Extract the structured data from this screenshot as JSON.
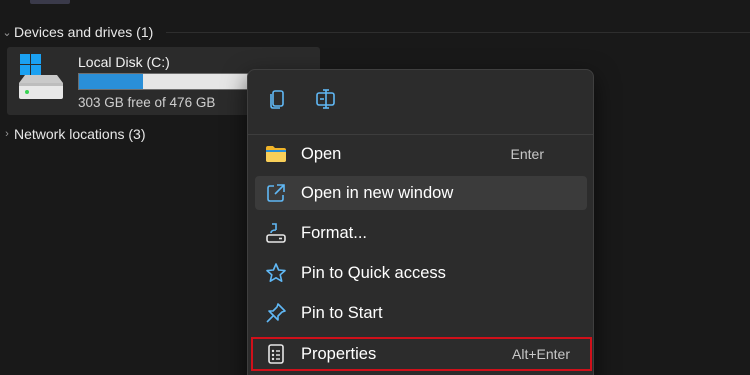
{
  "explorer": {
    "devices_header": "Devices and drives (1)",
    "network_header": "Network locations (3)",
    "drive": {
      "name": "Local Disk (C:)",
      "free_text": "303 GB free of 476 GB",
      "used_fraction": 0.36,
      "icon": "hard-drive-windows-icon"
    }
  },
  "context_menu": {
    "toolbar": [
      {
        "name": "copy-icon"
      },
      {
        "name": "rename-icon"
      }
    ],
    "items": [
      {
        "label": "Open",
        "shortcut": "Enter",
        "icon": "folder-icon"
      },
      {
        "label": "Open in new window",
        "shortcut": "",
        "icon": "open-new-window-icon"
      },
      {
        "label": "Format...",
        "shortcut": "",
        "icon": "format-icon"
      },
      {
        "label": "Pin to Quick access",
        "shortcut": "",
        "icon": "star-icon"
      },
      {
        "label": "Pin to Start",
        "shortcut": "",
        "icon": "pin-icon"
      },
      {
        "label": "Properties",
        "shortcut": "Alt+Enter",
        "icon": "properties-icon",
        "highlighted": true
      }
    ]
  },
  "colors": {
    "accent": "#2a8fd8",
    "highlight_border": "#d0101a",
    "background": "#191919",
    "menu_background": "#2c2c2c"
  }
}
